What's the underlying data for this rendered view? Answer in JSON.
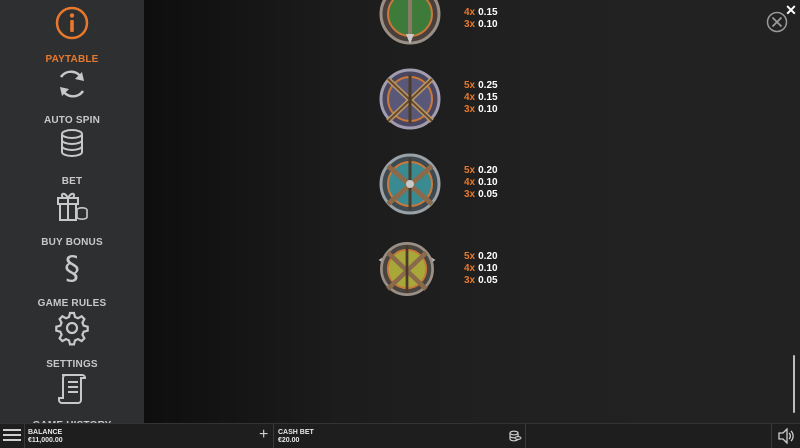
{
  "sidebar": {
    "items": [
      {
        "label": "PAYTABLE",
        "icon": "info-icon",
        "active": true
      },
      {
        "label": "AUTO SPIN",
        "icon": "refresh-icon",
        "active": false
      },
      {
        "label": "BET",
        "icon": "coins-stack-icon",
        "active": false
      },
      {
        "label": "BUY BONUS",
        "icon": "gift-coins-icon",
        "active": false
      },
      {
        "label": "GAME RULES",
        "icon": "section-sign-icon",
        "active": false
      },
      {
        "label": "SETTINGS",
        "icon": "gear-icon",
        "active": false
      },
      {
        "label": "GAME HISTORY",
        "icon": "scroll-icon",
        "active": false
      }
    ]
  },
  "paytable": {
    "symbols": [
      {
        "name": "green-shield-symbol",
        "payouts": [
          {
            "mult": "4x",
            "value": "0.15"
          },
          {
            "mult": "3x",
            "value": "0.10"
          }
        ]
      },
      {
        "name": "crossed-swords-symbol",
        "payouts": [
          {
            "mult": "5x",
            "value": "0.25"
          },
          {
            "mult": "4x",
            "value": "0.15"
          },
          {
            "mult": "3x",
            "value": "0.10"
          }
        ]
      },
      {
        "name": "teal-shield-axes-symbol",
        "payouts": [
          {
            "mult": "5x",
            "value": "0.20"
          },
          {
            "mult": "4x",
            "value": "0.10"
          },
          {
            "mult": "3x",
            "value": "0.05"
          }
        ]
      },
      {
        "name": "yellow-shield-axes-symbol",
        "payouts": [
          {
            "mult": "5x",
            "value": "0.20"
          },
          {
            "mult": "4x",
            "value": "0.10"
          },
          {
            "mult": "3x",
            "value": "0.05"
          }
        ]
      }
    ]
  },
  "bottom_bar": {
    "balance_label": "BALANCE",
    "balance_value": "€11,000.00",
    "plus_symbol": "+",
    "cash_bet_label": "CASH BET",
    "cash_bet_value": "€20.00"
  },
  "colors": {
    "accent": "#e8792c",
    "sidebar_bg": "#2e2f31"
  }
}
